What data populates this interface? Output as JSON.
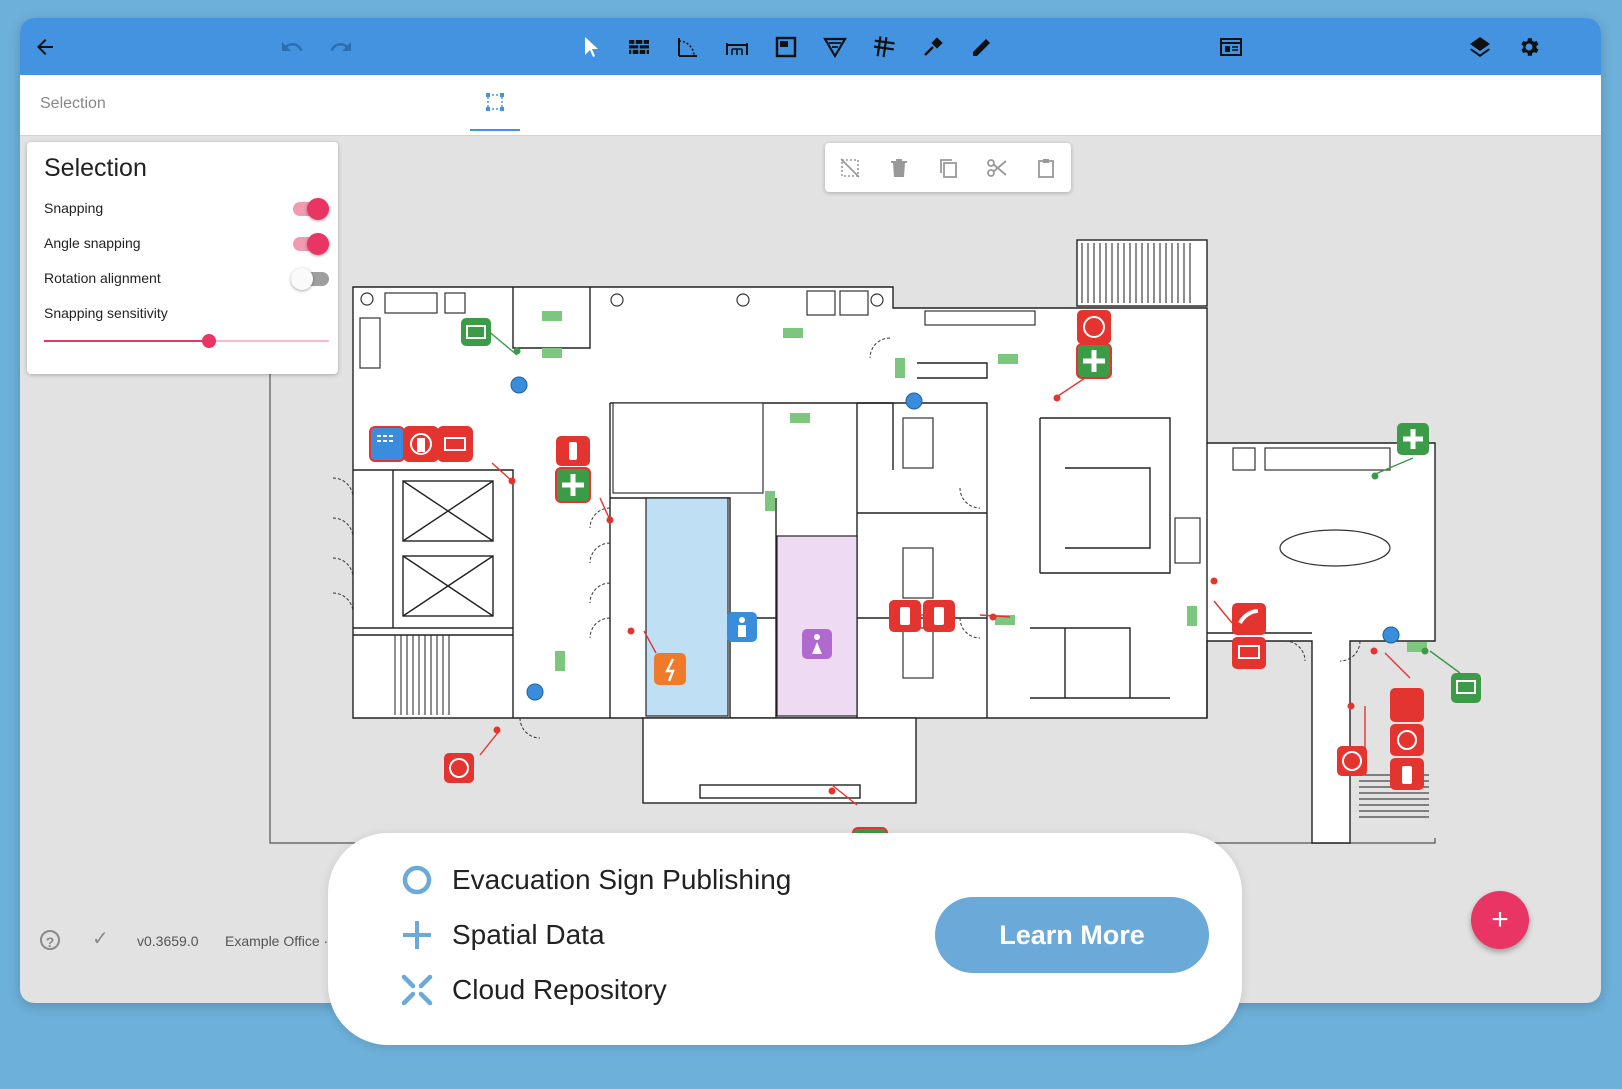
{
  "toolbar": {
    "back_icon": "arrow-left-icon",
    "undo_icon": "undo-icon",
    "redo_icon": "redo-icon",
    "tools": [
      "cursor-icon",
      "wall-icon",
      "angle-icon",
      "dimension-icon",
      "room-icon",
      "filter-icon",
      "grid-icon",
      "pin-tool-icon",
      "pencil-icon"
    ],
    "view_icon": "view-icon",
    "layers_icon": "layers-icon",
    "settings_icon": "gear-icon",
    "color": "#4393e0"
  },
  "subbar": {
    "title": "Selection",
    "tab_icon": "selection-box-icon"
  },
  "panel": {
    "title": "Selection",
    "options": [
      {
        "label": "Snapping",
        "on": true
      },
      {
        "label": "Angle snapping",
        "on": true
      },
      {
        "label": "Rotation alignment",
        "on": false
      }
    ],
    "sensitivity_label": "Snapping sensitivity",
    "sensitivity_value": 0.58
  },
  "edit_tools": [
    "deselect-icon",
    "trash-icon",
    "copy-icon",
    "scissors-icon",
    "clipboard-icon"
  ],
  "status": {
    "help_icon": "help-icon",
    "check_icon": "check-icon",
    "version": "v0.3659.0",
    "project": "Example Office ·"
  },
  "fab": {
    "label": "+",
    "color": "#e83563"
  },
  "promo": {
    "features": [
      {
        "icon": "circle-icon",
        "label": "Evacuation Sign Publishing"
      },
      {
        "icon": "plus-icon",
        "label": "Spatial Data"
      },
      {
        "icon": "cross-arrows-icon",
        "label": "Cloud Repository"
      }
    ],
    "button": "Learn More",
    "accent": "#6aa9d8"
  },
  "signs": {
    "red": "#e3342f",
    "green": "#3b9b47",
    "blue": "#3a8ddb",
    "orange": "#ef7a2a",
    "purple": "#b069cf"
  }
}
